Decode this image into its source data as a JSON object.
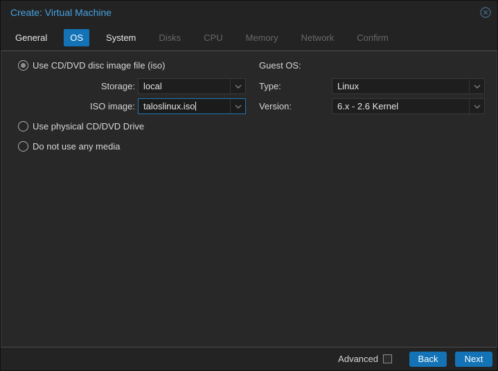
{
  "dialog": {
    "title": "Create: Virtual Machine"
  },
  "tabs": [
    {
      "label": "General",
      "state": "enabled"
    },
    {
      "label": "OS",
      "state": "active"
    },
    {
      "label": "System",
      "state": "enabled"
    },
    {
      "label": "Disks",
      "state": "disabled"
    },
    {
      "label": "CPU",
      "state": "disabled"
    },
    {
      "label": "Memory",
      "state": "disabled"
    },
    {
      "label": "Network",
      "state": "disabled"
    },
    {
      "label": "Confirm",
      "state": "disabled"
    }
  ],
  "media": {
    "options": [
      {
        "label": "Use CD/DVD disc image file (iso)",
        "selected": true
      },
      {
        "label": "Use physical CD/DVD Drive",
        "selected": false
      },
      {
        "label": "Do not use any media",
        "selected": false
      }
    ],
    "storage": {
      "label": "Storage:",
      "value": "local"
    },
    "iso": {
      "label": "ISO image:",
      "value": "taloslinux.iso",
      "focused": true
    }
  },
  "guest_os": {
    "heading": "Guest OS:",
    "type": {
      "label": "Type:",
      "value": "Linux"
    },
    "version": {
      "label": "Version:",
      "value": "6.x - 2.6 Kernel"
    }
  },
  "footer": {
    "advanced_label": "Advanced",
    "advanced_checked": false,
    "back_label": "Back",
    "next_label": "Next"
  },
  "icons": {
    "close": "circle-x-icon",
    "dropdown": "chevron-down-icon"
  },
  "colors": {
    "accent_blue": "#1373b6",
    "title_blue": "#47a3e3",
    "focus_border": "#2077b4",
    "panel_bg": "#282828",
    "header_bg": "#232323",
    "field_bg": "#1e1e1e"
  }
}
